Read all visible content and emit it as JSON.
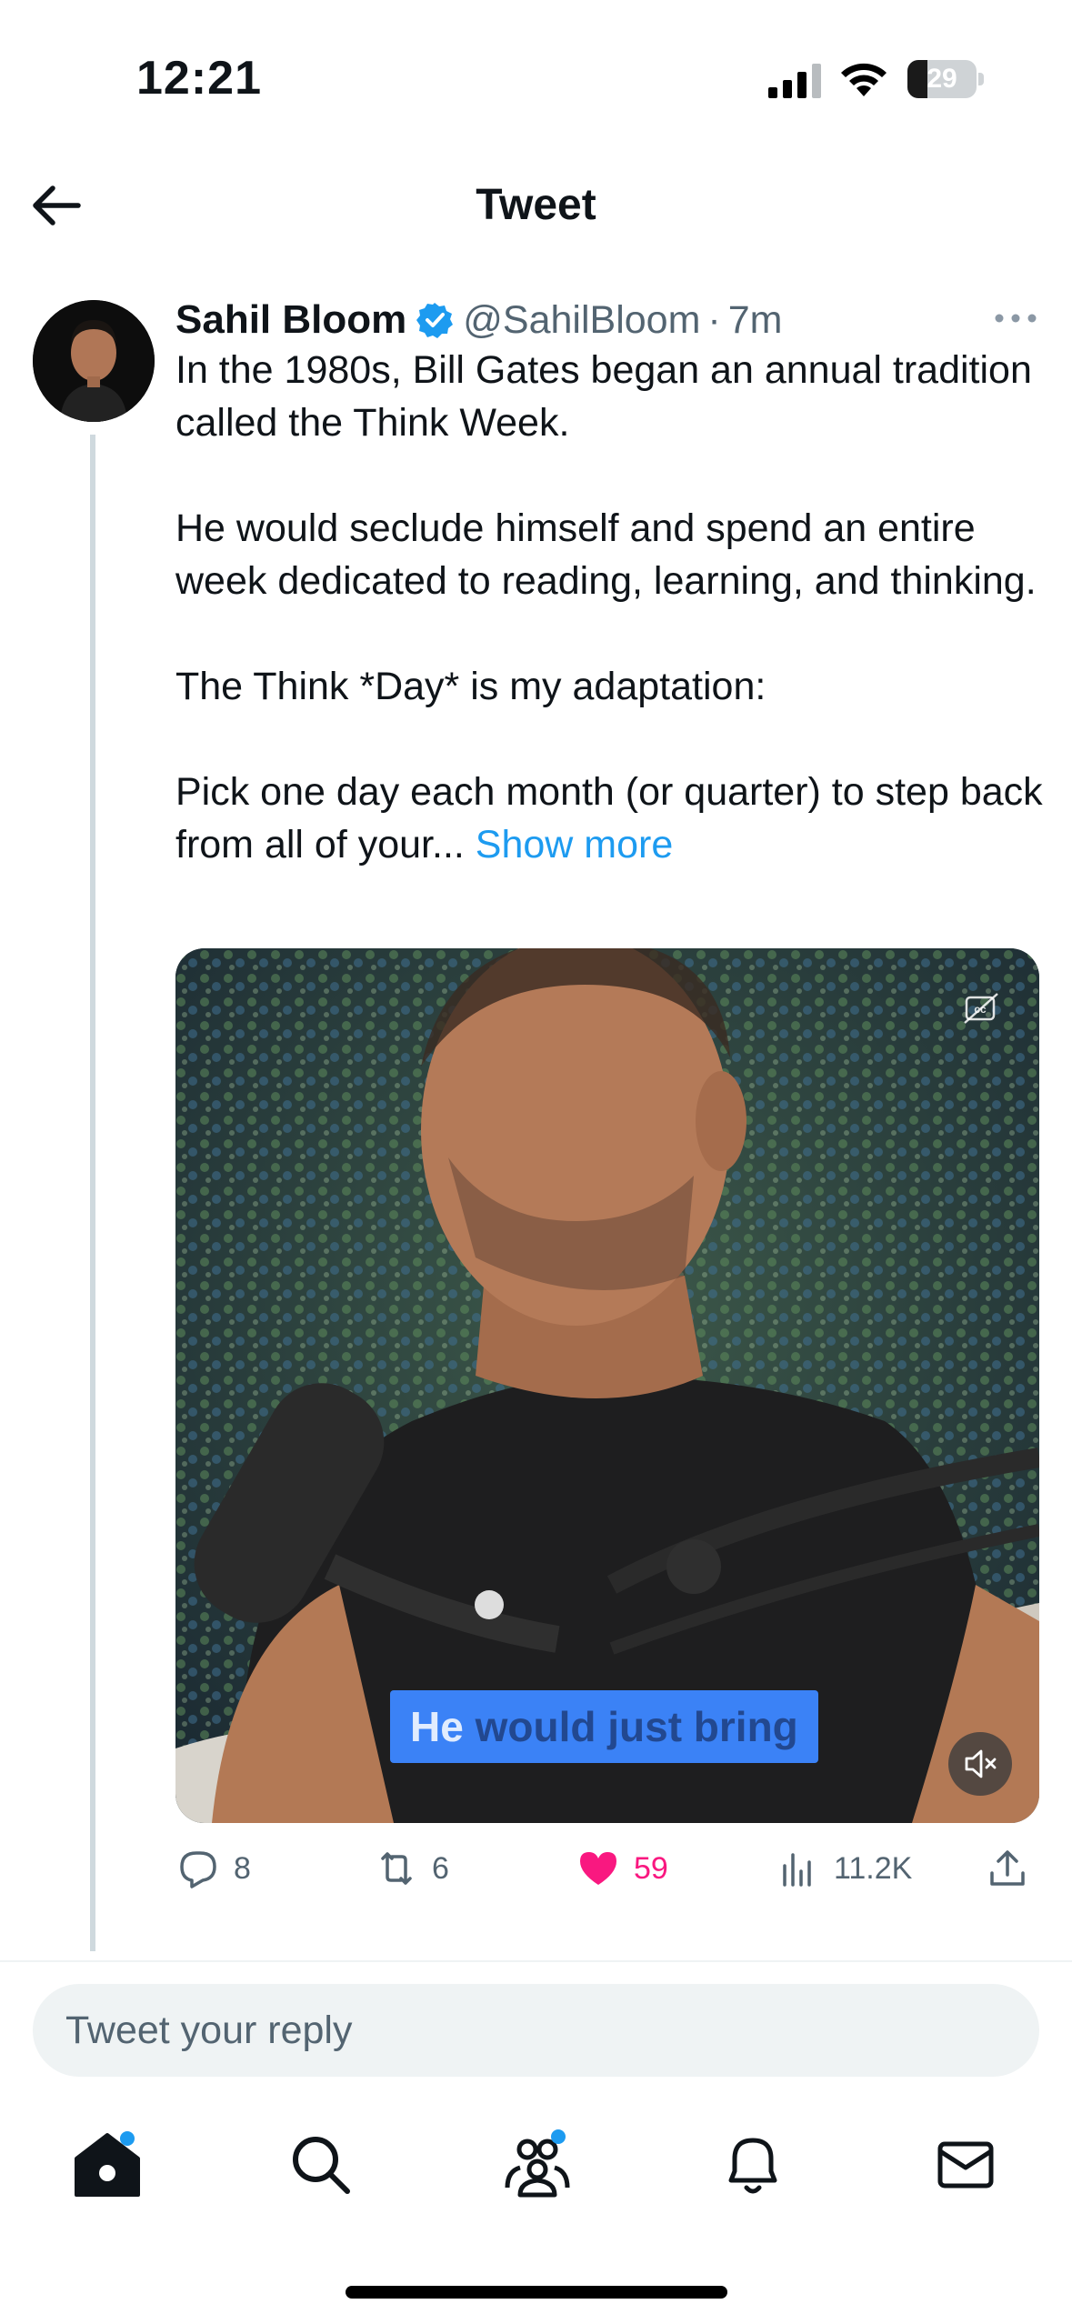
{
  "status_bar": {
    "time": "12:21",
    "battery": "29",
    "battery_level": 0.29
  },
  "header": {
    "title": "Tweet"
  },
  "tweet": {
    "author_name": "Sahil Bloom",
    "handle": "@SahilBloom",
    "separator": "·",
    "time": "7m",
    "paragraphs": [
      "In the 1980s, Bill Gates began an annual tradition called the Think Week.",
      "He would seclude himself and spend an entire week dedicated to reading, learning, and thinking.",
      "The Think *Day* is my adaptation:",
      "Pick one day each month (or quarter) to step back from all of your..."
    ],
    "show_more": "Show more",
    "video_caption_first": "He",
    "video_caption_rest": " would just bring",
    "actions": {
      "replies": "8",
      "retweets": "6",
      "likes": "59",
      "views": "11.2K"
    }
  },
  "reply": {
    "placeholder": "Tweet your reply"
  },
  "tabbar": {
    "items": [
      "home",
      "search",
      "communities",
      "notifications",
      "messages"
    ]
  },
  "colors": {
    "accent": "#1d9bf0",
    "like": "#f91880",
    "muted": "#536471"
  }
}
